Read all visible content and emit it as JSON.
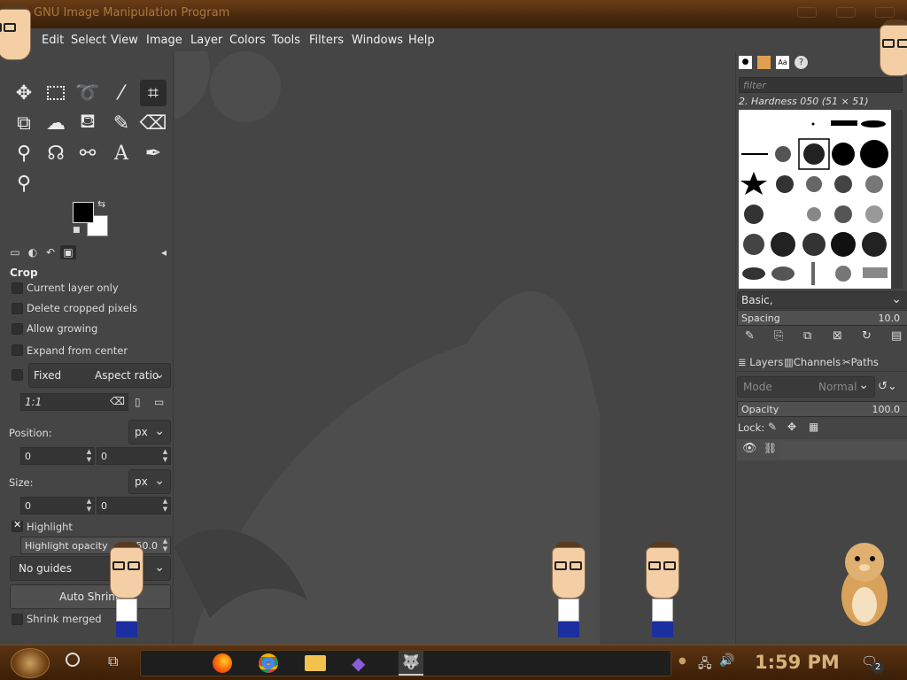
{
  "window": {
    "title": "GNU Image Manipulation Program"
  },
  "menu": [
    "Edit",
    "Select",
    "View",
    "Image",
    "Layer",
    "Colors",
    "Tools",
    "Filters",
    "Windows",
    "Help"
  ],
  "tool_options": {
    "title": "Crop",
    "current_layer_only": "Current layer only",
    "delete_cropped_pixels": "Delete cropped pixels",
    "allow_growing": "Allow growing",
    "expand_from_center": "Expand from center",
    "fixed_label": "Fixed",
    "fixed_mode": "Aspect ratio",
    "ratio_value": "1:1",
    "position_label": "Position:",
    "position_unit": "px",
    "position_x": "0",
    "position_y": "0",
    "size_label": "Size:",
    "size_unit": "px",
    "size_w": "0",
    "size_h": "0",
    "highlight": "Highlight",
    "highlight_opacity_label": "Highlight opacity",
    "highlight_opacity_value": "50.0",
    "guides": "No guides",
    "auto_shrink": "Auto Shrink",
    "shrink_merged": "Shrink merged"
  },
  "brushes": {
    "filter_placeholder": "filter",
    "selected": "2. Hardness 050 (51 × 51)",
    "preset": "Basic,",
    "spacing_label": "Spacing",
    "spacing_value": "10.0"
  },
  "layers": {
    "tabs": [
      "Layers",
      "Channels",
      "Paths"
    ],
    "mode_label": "Mode",
    "mode_value": "Normal",
    "opacity_label": "Opacity",
    "opacity_value": "100.0",
    "lock_label": "Lock:"
  },
  "taskbar": {
    "clock": "1:59 PM",
    "notification_count": "2"
  }
}
